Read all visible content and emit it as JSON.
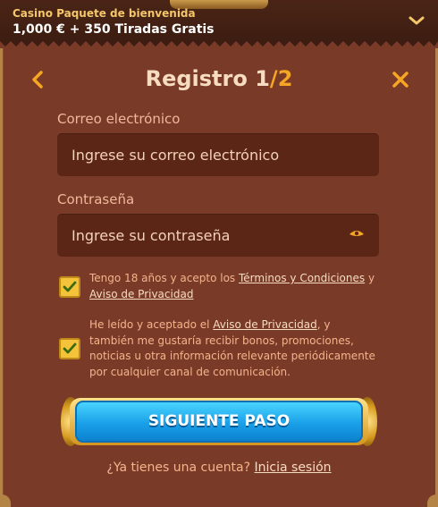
{
  "promo": {
    "subtitle": "Casino Paquete de bienvenida",
    "headline": "1,000 € + 350 Tiradas Gratis"
  },
  "header": {
    "title_main": "Registro 1",
    "title_sep": "/",
    "title_total": "2"
  },
  "form": {
    "email": {
      "label": "Correo electrónico",
      "placeholder": "Ingrese su correo electrónico",
      "value": ""
    },
    "password": {
      "label": "Contraseña",
      "placeholder": "Ingrese su contraseña",
      "value": ""
    }
  },
  "consents": {
    "age": {
      "checked": true,
      "text_1": "Tengo 18 años y acepto los ",
      "link_1": "Términos y Condiciones",
      "text_2": " y ",
      "link_2": "Aviso de Privacidad"
    },
    "marketing": {
      "checked": true,
      "text_1": "He leído y aceptado el ",
      "link_1": "Aviso de Privacidad",
      "text_2": ", y también me gustaría recibir bonos, promociones, noticias u otra información relevante periódicamente por cualquier canal de comunicación."
    }
  },
  "cta": {
    "label": "SIGUIENTE PASO"
  },
  "login": {
    "question": "¿Ya tienes una cuenta? ",
    "link": "Inicia sesión"
  },
  "colors": {
    "panel_bg": "#7a3a28",
    "input_bg": "#5c2617",
    "accent_orange": "#f5a623",
    "cta_blue": "#1aa0e8",
    "checkbox_yellow": "#f5c33a"
  },
  "icons": {
    "expand": "chevron-down-icon",
    "back": "chevron-left-icon",
    "close": "close-icon",
    "reveal": "eye-icon",
    "check": "checkmark-icon"
  }
}
